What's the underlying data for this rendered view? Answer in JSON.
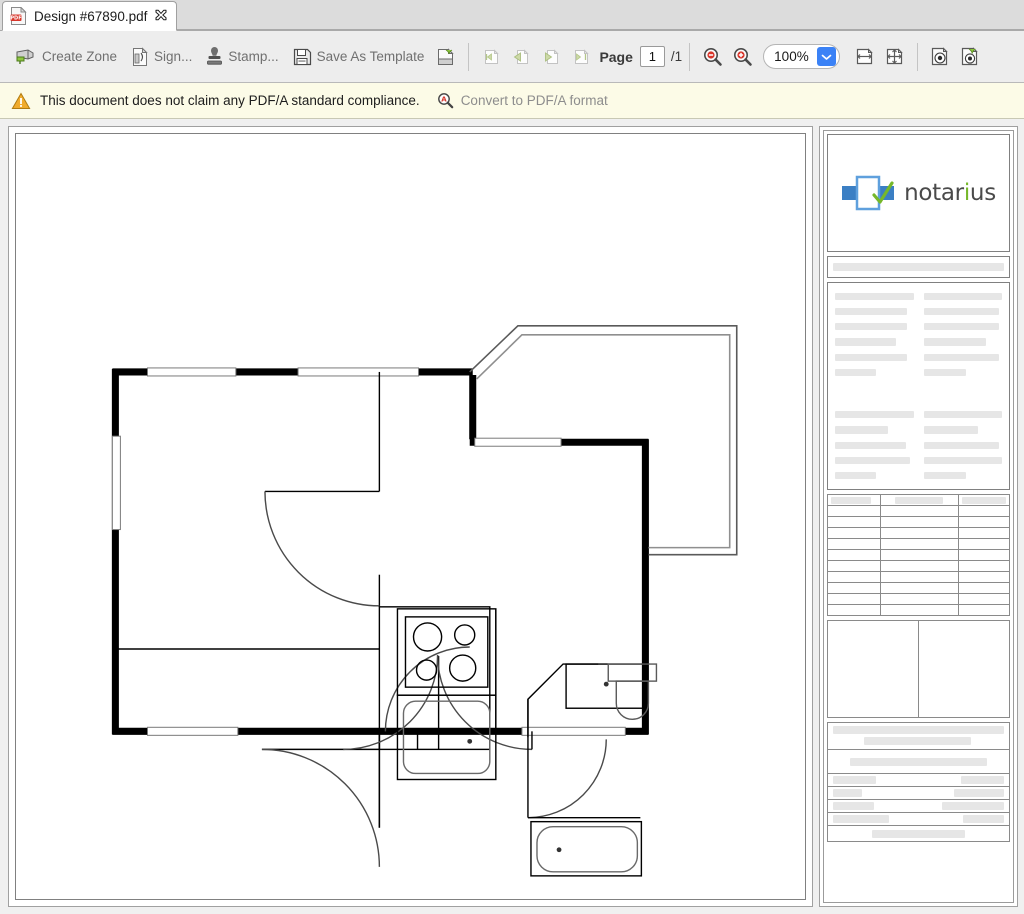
{
  "tab": {
    "title": "Design #67890.pdf",
    "file_icon": "pdf-file-icon",
    "close_icon": "close-icon"
  },
  "toolbar": {
    "create_zone_label": "Create Zone",
    "create_zone_icon": "create-zone-icon",
    "sign_label": "Sign...",
    "sign_icon": "sign-document-icon",
    "stamp_label": "Stamp...",
    "stamp_icon": "stamp-icon",
    "save_as_template_label": "Save As Template",
    "save_as_template_icon": "save-template-icon",
    "apply_template_icon": "apply-template-icon",
    "nav_first_icon": "nav-first-zone-icon",
    "nav_prev_icon": "nav-previous-zone-icon",
    "nav_next_icon": "nav-next-zone-icon",
    "nav_last_icon": "nav-last-zone-icon",
    "page_label": "Page",
    "page_value": "1",
    "page_total": "/1",
    "zoom_out_icon": "zoom-out-icon",
    "zoom_in_icon": "zoom-in-icon",
    "zoom_value": "100%",
    "zoom_dropdown_icon": "chevron-down-icon",
    "fit_width_icon": "fit-width-icon",
    "fit_page_icon": "fit-page-icon",
    "preview_icon": "preview-document-icon",
    "certify_icon": "certify-document-icon",
    "accent_color": "#3b82f6"
  },
  "warning": {
    "icon": "warning-triangle-icon",
    "message": "This document does not claim any PDF/A standard compliance.",
    "link_icon": "convert-pdfa-icon",
    "link_label": "Convert to PDF/A format",
    "background_color": "#fcfbe7"
  },
  "document": {
    "name": "floor-plan-drawing",
    "description": "Architectural floor plan"
  },
  "sidebar": {
    "brand": {
      "logo_icon": "notarius-logo-icon",
      "name_part1": "notar",
      "name_accent": "i",
      "name_part2": "us",
      "blue": "#3b7fc4",
      "green": "#76b82a"
    },
    "placeholder_color": "#e6e6e6",
    "table": {
      "rows": 11,
      "columns": 3,
      "header_cells": [
        "",
        "",
        ""
      ]
    },
    "blocks": [
      "logo-block",
      "thin-bar-block",
      "two-column-text-block",
      "data-table-block",
      "two-up-image-block",
      "footer-rows-block"
    ]
  }
}
